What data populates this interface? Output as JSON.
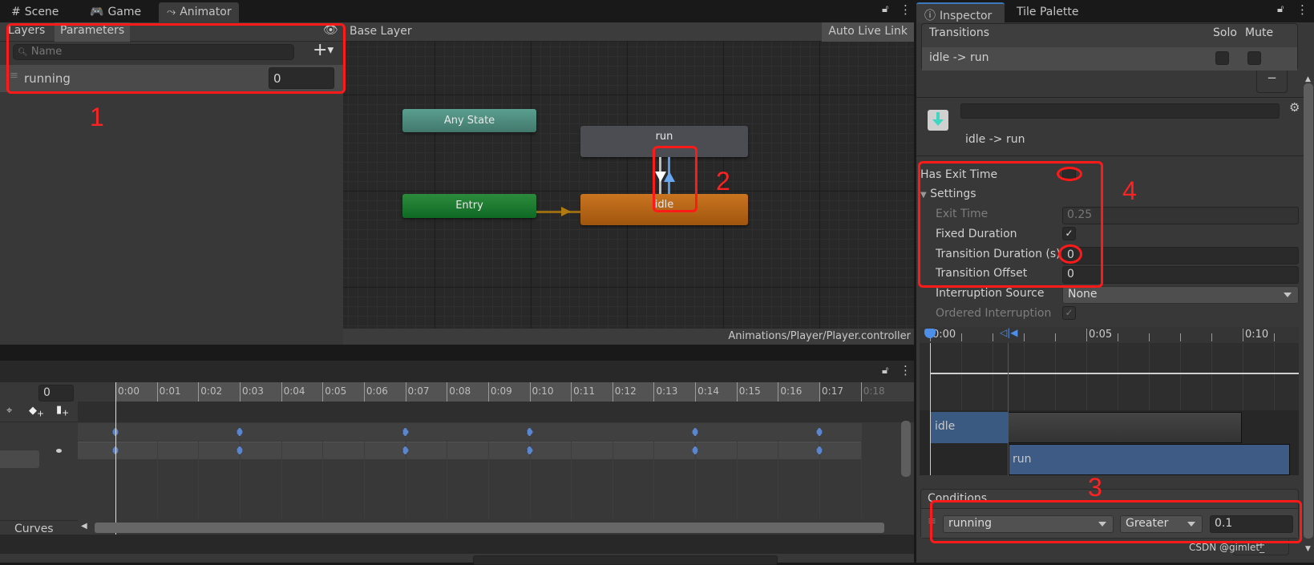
{
  "tabs": {
    "scene": "Scene",
    "game": "Game",
    "animator": "Animator",
    "inspector": "Inspector",
    "tile_palette": "Tile Palette"
  },
  "animator": {
    "layers_tab": "Layers",
    "parameters_tab": "Parameters",
    "search_placeholder": "Name",
    "parameters": [
      {
        "name": "running",
        "value": "0"
      }
    ],
    "breadcrumb": "Base Layer",
    "auto_live_link": "Auto Live Link",
    "path": "Animations/Player/Player.controller",
    "states": {
      "any": "Any State",
      "entry": "Entry",
      "run": "run",
      "idle": "idle"
    }
  },
  "animation": {
    "frame": "0",
    "curves": "Curves",
    "ticks": [
      "0:00",
      "0:01",
      "0:02",
      "0:03",
      "0:04",
      "0:05",
      "0:06",
      "0:07",
      "0:08",
      "0:09",
      "0:10",
      "0:11",
      "0:12",
      "0:13",
      "0:14",
      "0:15",
      "0:16",
      "0:17",
      "0:18"
    ],
    "keyframes": [
      0,
      3,
      7,
      10,
      14,
      17
    ]
  },
  "inspector": {
    "transitions_header": "Transitions",
    "solo": "Solo",
    "mute": "Mute",
    "transition_row": "idle -> run",
    "title": "idle -> run",
    "has_exit_time": {
      "label": "Has Exit Time",
      "checked": false
    },
    "settings": "Settings",
    "exit_time": {
      "label": "Exit Time",
      "value": "0.25"
    },
    "fixed_duration": {
      "label": "Fixed Duration",
      "checked": true
    },
    "transition_duration": {
      "label": "Transition Duration (s)",
      "value": "0"
    },
    "transition_offset": {
      "label": "Transition Offset",
      "value": "0"
    },
    "interruption_source": {
      "label": "Interruption Source",
      "value": "None"
    },
    "ordered_interruption": {
      "label": "Ordered Interruption",
      "checked": true
    },
    "timeline_ticks": [
      "0:00",
      "0:05",
      "0:10"
    ],
    "bars": {
      "from": "idle",
      "to": "run"
    },
    "conditions": {
      "header": "Conditions",
      "parameter": "running",
      "mode": "Greater",
      "value": "0.1"
    }
  },
  "annotations": {
    "labels": [
      "1",
      "2",
      "3",
      "4"
    ],
    "color": "#ff1a1a"
  },
  "watermark": "CSDN @gimlet_"
}
